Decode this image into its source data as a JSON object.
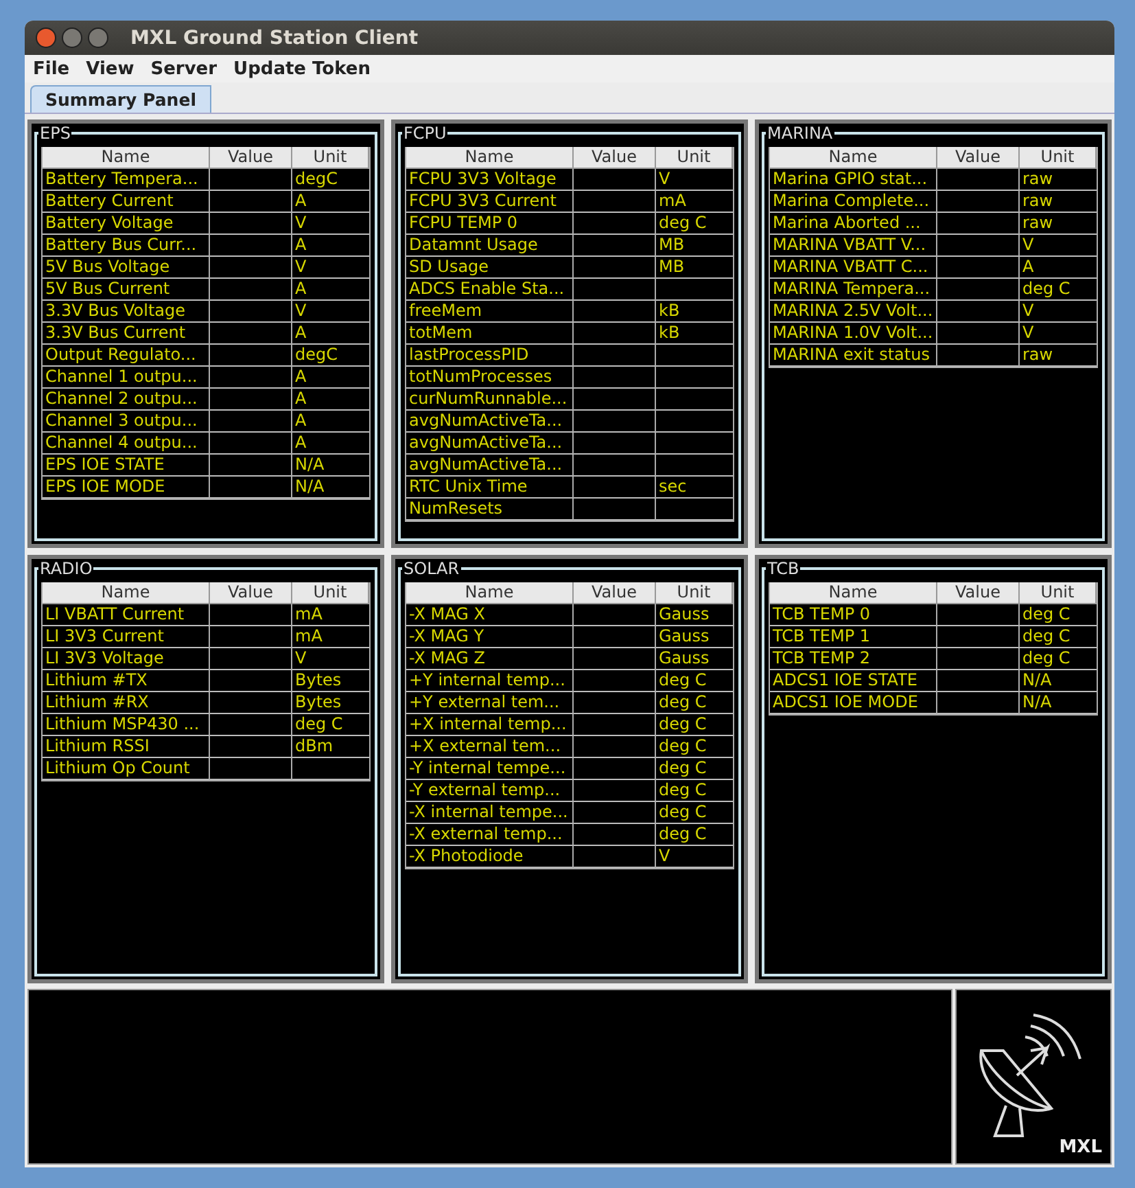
{
  "window": {
    "title": "MXL Ground Station Client"
  },
  "menu": [
    "File",
    "View",
    "Server",
    "Update Token"
  ],
  "tabs": [
    {
      "label": "Summary Panel",
      "selected": true
    }
  ],
  "panels": [
    {
      "title": "EPS",
      "columns": [
        "Name",
        "Value",
        "Unit"
      ],
      "rows": [
        {
          "name": "Battery Tempera...",
          "unit": "degC"
        },
        {
          "name": "Battery Current",
          "unit": "A"
        },
        {
          "name": "Battery Voltage",
          "unit": "V"
        },
        {
          "name": "Battery Bus Curr...",
          "unit": "A"
        },
        {
          "name": "5V Bus Voltage",
          "unit": "V"
        },
        {
          "name": "5V Bus Current",
          "unit": "A"
        },
        {
          "name": "3.3V Bus Voltage",
          "unit": "V"
        },
        {
          "name": "3.3V Bus Current",
          "unit": "A"
        },
        {
          "name": "Output Regulato...",
          "unit": "degC"
        },
        {
          "name": "Channel 1 outpu...",
          "unit": "A"
        },
        {
          "name": "Channel 2 outpu...",
          "unit": "A"
        },
        {
          "name": "Channel 3 outpu...",
          "unit": "A"
        },
        {
          "name": "Channel 4 outpu...",
          "unit": "A"
        },
        {
          "name": "EPS IOE STATE",
          "unit": "N/A"
        },
        {
          "name": "EPS IOE MODE",
          "unit": "N/A"
        }
      ]
    },
    {
      "title": "FCPU",
      "columns": [
        "Name",
        "Value",
        "Unit"
      ],
      "rows": [
        {
          "name": "FCPU 3V3 Voltage",
          "unit": "V"
        },
        {
          "name": "FCPU 3V3 Current",
          "unit": "mA"
        },
        {
          "name": "FCPU TEMP 0",
          "unit": "deg C"
        },
        {
          "name": "Datamnt Usage",
          "unit": "MB"
        },
        {
          "name": "SD Usage",
          "unit": "MB"
        },
        {
          "name": "ADCS Enable Sta..."
        },
        {
          "name": "freeMem",
          "unit": "kB"
        },
        {
          "name": "totMem",
          "unit": "kB"
        },
        {
          "name": "lastProcessPID"
        },
        {
          "name": "totNumProcesses"
        },
        {
          "name": "curNumRunnable..."
        },
        {
          "name": "avgNumActiveTa..."
        },
        {
          "name": "avgNumActiveTa..."
        },
        {
          "name": "avgNumActiveTa..."
        },
        {
          "name": "RTC Unix Time",
          "unit": "sec"
        },
        {
          "name": "NumResets"
        }
      ]
    },
    {
      "title": "MARINA",
      "columns": [
        "Name",
        "Value",
        "Unit"
      ],
      "rows": [
        {
          "name": "Marina GPIO stat...",
          "unit": "raw"
        },
        {
          "name": "Marina Complete...",
          "unit": "raw"
        },
        {
          "name": "Marina Aborted ...",
          "unit": "raw"
        },
        {
          "name": "MARINA VBATT V...",
          "unit": "V"
        },
        {
          "name": "MARINA VBATT C...",
          "unit": "A"
        },
        {
          "name": "MARINA Tempera...",
          "unit": "deg C"
        },
        {
          "name": "MARINA 2.5V Volt...",
          "unit": "V"
        },
        {
          "name": "MARINA 1.0V Volt...",
          "unit": "V"
        },
        {
          "name": "MARINA exit status",
          "unit": "raw"
        }
      ]
    },
    {
      "title": "RADIO",
      "columns": [
        "Name",
        "Value",
        "Unit"
      ],
      "rows": [
        {
          "name": "LI VBATT Current",
          "unit": "mA"
        },
        {
          "name": "LI 3V3 Current",
          "unit": "mA"
        },
        {
          "name": "LI 3V3 Voltage",
          "unit": "V"
        },
        {
          "name": "Lithium #TX",
          "unit": "Bytes"
        },
        {
          "name": "Lithium #RX",
          "unit": "Bytes"
        },
        {
          "name": "Lithium MSP430 ...",
          "unit": "deg C"
        },
        {
          "name": "Lithium RSSI",
          "unit": "dBm"
        },
        {
          "name": "Lithium Op Count"
        }
      ]
    },
    {
      "title": "SOLAR",
      "columns": [
        "Name",
        "Value",
        "Unit"
      ],
      "rows": [
        {
          "name": "-X MAG X",
          "unit": "Gauss"
        },
        {
          "name": "-X MAG Y",
          "unit": "Gauss"
        },
        {
          "name": "-X MAG Z",
          "unit": "Gauss"
        },
        {
          "name": "+Y internal temp...",
          "unit": "deg C"
        },
        {
          "name": "+Y external tem...",
          "unit": "deg C"
        },
        {
          "name": "+X internal temp...",
          "unit": "deg C"
        },
        {
          "name": "+X external tem...",
          "unit": "deg C"
        },
        {
          "name": "-Y internal tempe...",
          "unit": "deg C"
        },
        {
          "name": "-Y external temp...",
          "unit": "deg C"
        },
        {
          "name": "-X internal tempe...",
          "unit": "deg C"
        },
        {
          "name": "-X external temp...",
          "unit": "deg C"
        },
        {
          "name": "-X Photodiode",
          "unit": "V"
        }
      ]
    },
    {
      "title": "TCB",
      "columns": [
        "Name",
        "Value",
        "Unit"
      ],
      "rows": [
        {
          "name": "TCB TEMP 0",
          "unit": "deg C"
        },
        {
          "name": "TCB TEMP 1",
          "unit": "deg C"
        },
        {
          "name": "TCB TEMP 2",
          "unit": "deg C"
        },
        {
          "name": "ADCS1 IOE STATE",
          "unit": "N/A"
        },
        {
          "name": "ADCS1 IOE MODE",
          "unit": "N/A"
        }
      ]
    }
  ],
  "logo": {
    "text": "MXL"
  }
}
